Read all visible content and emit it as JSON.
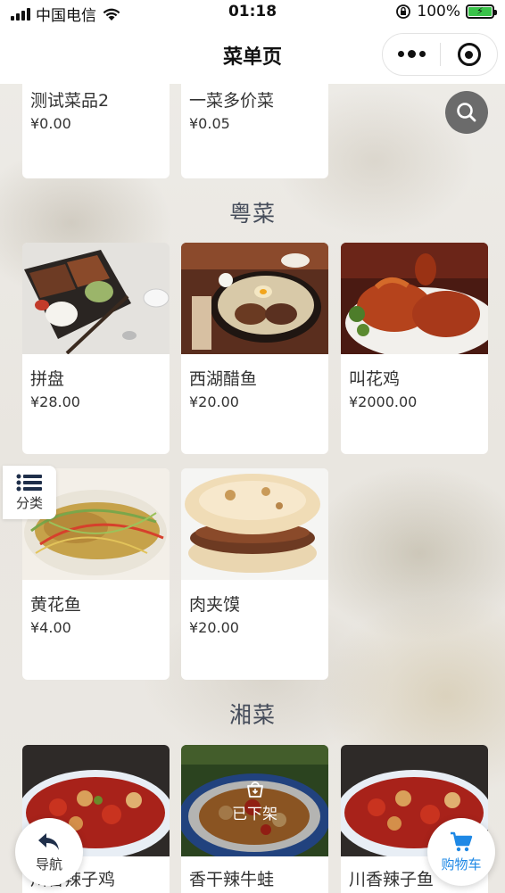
{
  "status_bar": {
    "carrier": "中国电信",
    "time": "01:18",
    "battery": "100%"
  },
  "nav": {
    "title": "菜单页"
  },
  "top_items": [
    {
      "name": "测试菜品2",
      "price": "¥0.00"
    },
    {
      "name": "一菜多价菜",
      "price": "¥0.05"
    }
  ],
  "sections": [
    {
      "title": "粤菜",
      "items": [
        {
          "name": "拼盘",
          "price": "¥28.00",
          "image": "bento-box-photo"
        },
        {
          "name": "西湖醋鱼",
          "price": "¥20.00",
          "image": "steak-plate-photo"
        },
        {
          "name": "叫花鸡",
          "price": "¥2000.00",
          "image": "roast-duck-photo"
        },
        {
          "name": "黄花鱼",
          "price": "¥4.00",
          "image": "braised-fish-photo"
        },
        {
          "name": "肉夹馍",
          "price": "¥20.00",
          "image": "roujiamo-photo"
        }
      ]
    },
    {
      "title": "湘菜",
      "items": [
        {
          "name": "川香辣子鸡",
          "image": "chili-chicken-photo"
        },
        {
          "name": "香干辣牛蛙",
          "image": "bullfrog-photo",
          "status": "已下架"
        },
        {
          "name": "川香辣子鱼",
          "image": "chili-fish-photo"
        }
      ]
    }
  ],
  "floating": {
    "category_label": "分类",
    "nav_label": "导航",
    "cart_label": "购物车"
  },
  "colors": {
    "cart_blue": "#1e88e5",
    "section_title": "#454c5a"
  }
}
